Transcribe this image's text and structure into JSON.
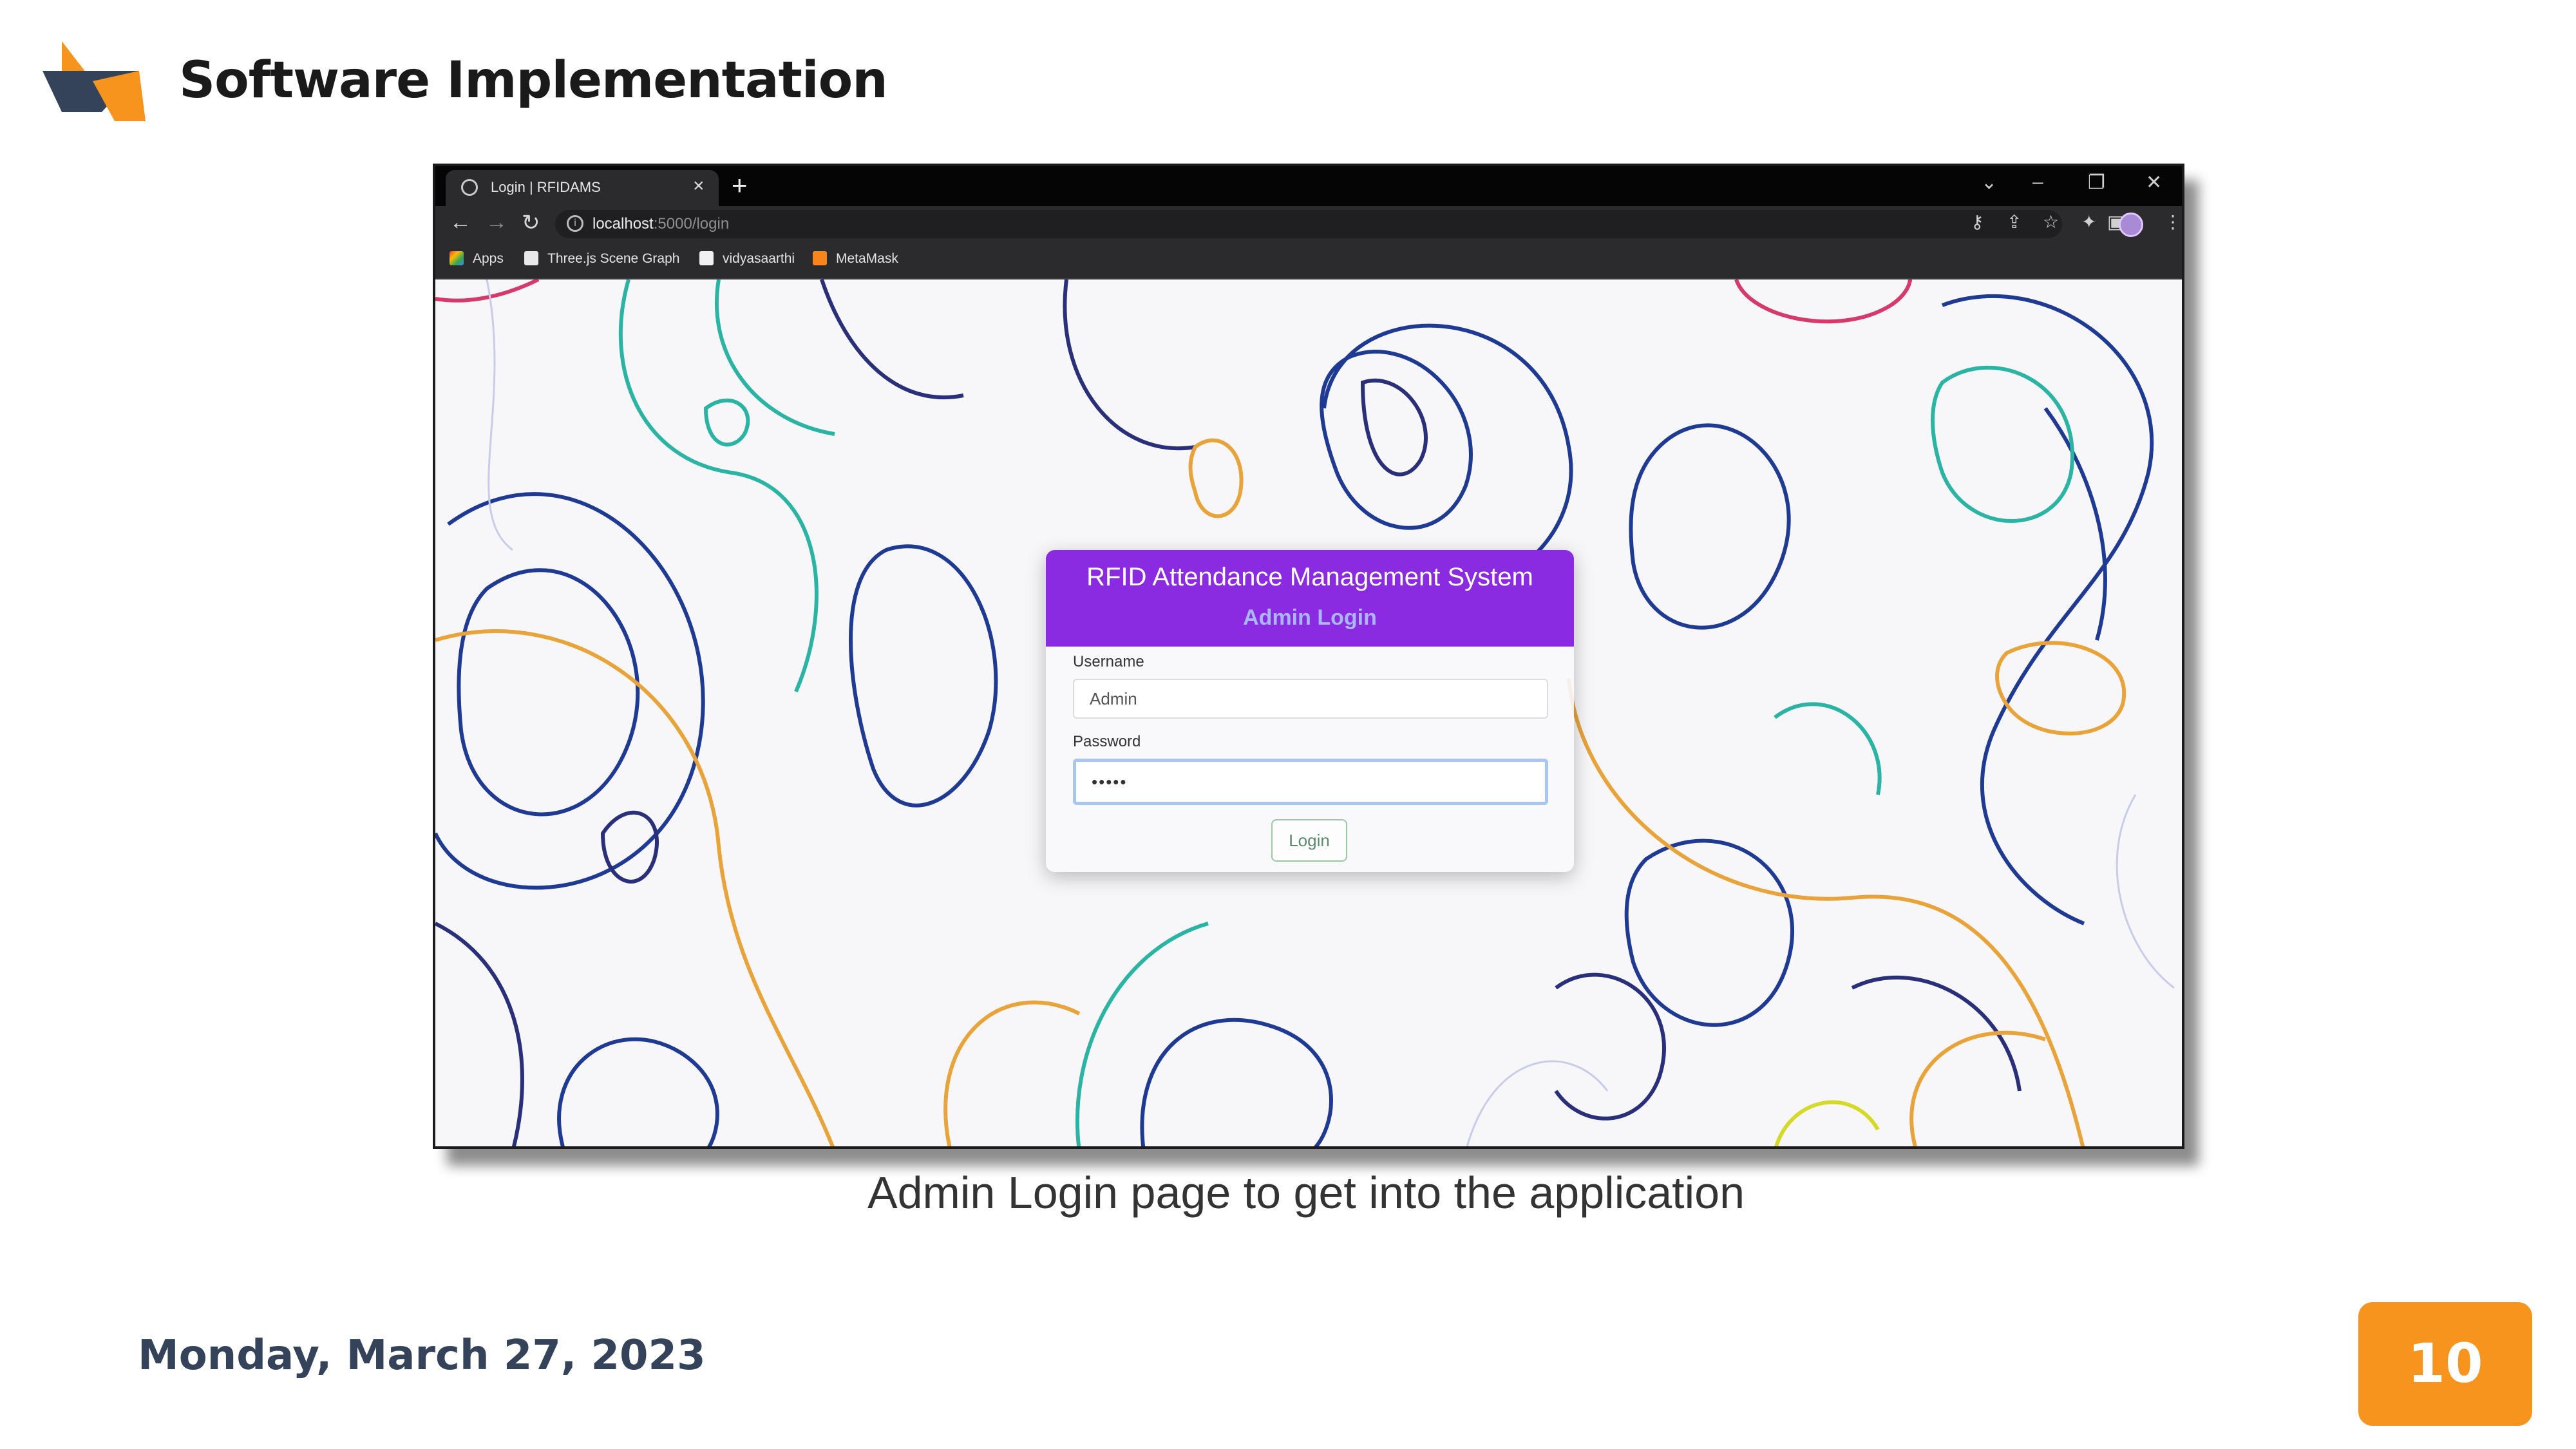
{
  "slide": {
    "title": "Software Implementation",
    "caption": "Admin Login page to get into the application",
    "date": "Monday, March 27, 2023",
    "page_number": "10",
    "colors": {
      "logo_orange": "#f7941d",
      "logo_dark": "#34435a",
      "badge": "#f7941d"
    }
  },
  "browser": {
    "tab_title": "Login | RFIDAMS",
    "url_host": "localhost",
    "url_path": ":5000/login",
    "bookmarks": [
      {
        "label": "Apps",
        "icon": "apps-grid-icon"
      },
      {
        "label": "Three.js Scene Graph",
        "icon": "page-icon"
      },
      {
        "label": "vidyasaarthi",
        "icon": "image-icon"
      },
      {
        "label": "MetaMask",
        "icon": "metamask-fox-icon"
      }
    ]
  },
  "login": {
    "heading": "RFID Attendance Management System",
    "subheading": "Admin Login",
    "username_label": "Username",
    "username_value": "Admin",
    "password_label": "Password",
    "password_value": "•••••",
    "button": "Login",
    "colors": {
      "header": "#8a2be2",
      "subheading": "#a9b7ff"
    }
  }
}
